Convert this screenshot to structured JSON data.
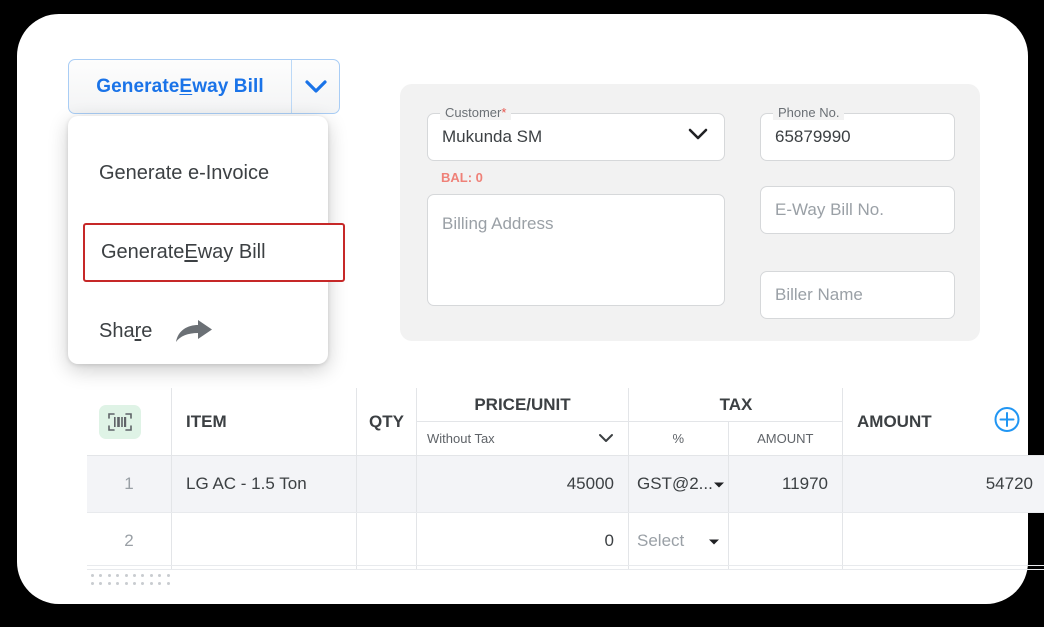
{
  "button": {
    "label_prefix": "Generate ",
    "label_accesskey": "E",
    "label_suffix": "way Bill",
    "caret_icon": "chevron-down-icon",
    "accent_color": "#1a73e8",
    "border_color": "#a9cdf5"
  },
  "menu": {
    "items": [
      {
        "label": "Generate e-Invoice",
        "highlighted": false
      },
      {
        "label_prefix": "Generate ",
        "label_accesskey": "E",
        "label_suffix": "way Bill",
        "highlighted": true
      },
      {
        "label_prefix": "Sha",
        "label_accesskey": "r",
        "label_suffix": "e",
        "icon": "share-arrow-icon",
        "highlighted": false
      }
    ],
    "highlight_color": "#c62828"
  },
  "customer_panel": {
    "background": "#f2f2f2",
    "customer": {
      "legend": "Customer",
      "required_marker": "*",
      "value": "Mukunda SM",
      "caret_icon": "chevron-down-icon"
    },
    "balance": {
      "text": "BAL: 0",
      "color": "#ef8178"
    },
    "phone": {
      "legend": "Phone No.",
      "value": "65879990"
    },
    "billing_address": {
      "placeholder": "Billing Address"
    },
    "eway_bill_no": {
      "placeholder": "E-Way Bill No."
    },
    "biller_name": {
      "placeholder": "Biller Name"
    }
  },
  "items_table": {
    "scan_icon": "barcode-scanner-icon",
    "add_row_icon": "plus-circle-icon",
    "headers": {
      "item": "ITEM",
      "qty": "QTY",
      "price_unit": "PRICE/UNIT",
      "price_unit_sub": "Without Tax",
      "price_unit_caret": "chevron-down-icon",
      "tax": "TAX",
      "tax_percent": "%",
      "tax_amount": "AMOUNT",
      "amount": "AMOUNT"
    },
    "rows": [
      {
        "index": "1",
        "item": "LG AC - 1.5 Ton",
        "qty": "",
        "price": "45000",
        "tax_percent": "GST@2...",
        "tax_percent_caret": "caret-down-icon",
        "tax_amount": "11970",
        "amount": "54720",
        "selected": true
      },
      {
        "index": "2",
        "item": "",
        "qty": "",
        "price": "0",
        "tax_percent": "Select",
        "tax_percent_caret": "caret-down-icon",
        "tax_amount": "",
        "amount": "",
        "selected": false
      }
    ]
  }
}
